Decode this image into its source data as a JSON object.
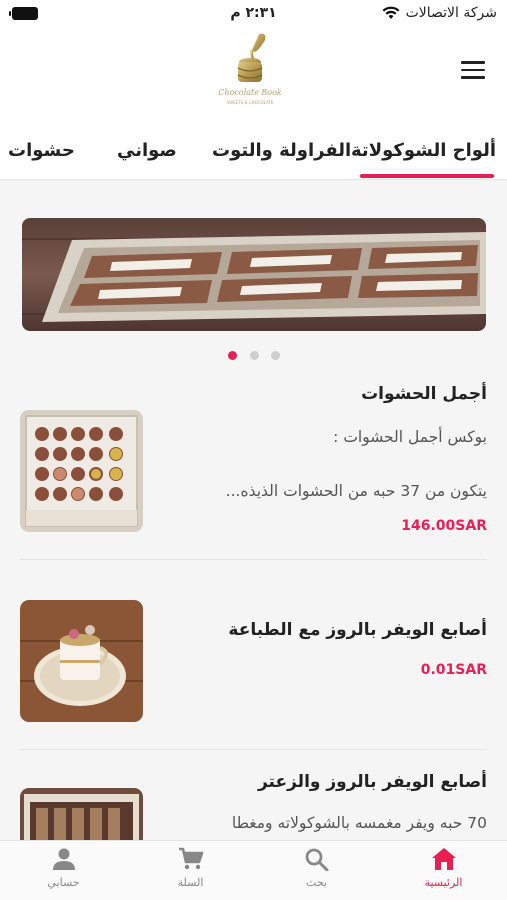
{
  "status_bar": {
    "carrier": "شركة الاتصالات",
    "time": "٢:٣١ م"
  },
  "header": {
    "logo_text": "Chocolate Book",
    "logo_sub": "SWEETS & CHOCOLATE"
  },
  "tabs": [
    {
      "label": "ألواح الشوكولاتة",
      "active": true
    },
    {
      "label": "الفراولة والتوت",
      "active": false
    },
    {
      "label": "صواني",
      "active": false
    },
    {
      "label": "حشوات",
      "active": false
    }
  ],
  "carousel": {
    "slide_count": 3,
    "active_index": 0
  },
  "products": [
    {
      "title": "أجمل الحشوات",
      "description_line1": "بوكس أجمل الحشوات :",
      "description_line2": "يتكون من 37 حبه من الحشوات الذيذه...",
      "price": "146.00SAR"
    },
    {
      "title": "أصابع الويفر بالروز مع الطباعة",
      "description_line1": "",
      "description_line2": "",
      "price": "0.01SAR"
    },
    {
      "title": "أصابع الويفر بالروز والزعتر",
      "description_line1": "70 حبه ويفر مغمسه بالشوكولاته ومغطا",
      "description_line2": "",
      "price": ""
    }
  ],
  "bottom_nav": [
    {
      "label": "الرئيسية",
      "icon": "home-icon",
      "active": true
    },
    {
      "label": "بحث",
      "icon": "search-icon",
      "active": false
    },
    {
      "label": "السلة",
      "icon": "cart-icon",
      "active": false
    },
    {
      "label": "حسابي",
      "icon": "account-icon",
      "active": false
    }
  ],
  "colors": {
    "accent": "#e91e52",
    "logo_gold": "#b8a06a"
  }
}
